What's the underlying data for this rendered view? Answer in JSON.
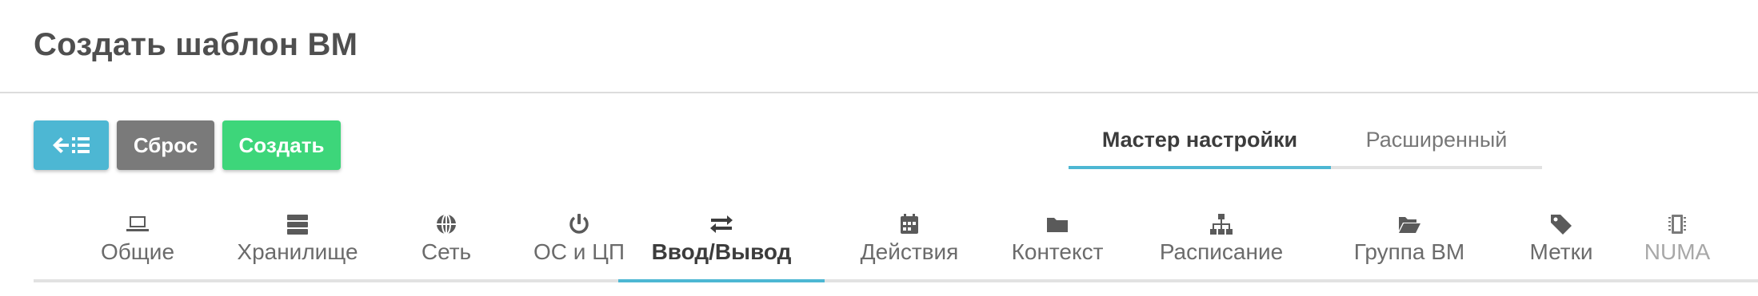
{
  "page": {
    "title": "Создать шаблон ВМ"
  },
  "toolbar": {
    "back_icon": "arrow-left-list-icon",
    "reset_label": "Сброс",
    "create_label": "Создать"
  },
  "mode_tabs": {
    "wizard": "Мастер настройки",
    "advanced": "Расширенный",
    "active": "wizard"
  },
  "section_tabs": {
    "active": "Ввод/Вывод",
    "items": [
      {
        "label": "Общие",
        "icon": "laptop-icon"
      },
      {
        "label": "Хранилище",
        "icon": "server-icon"
      },
      {
        "label": "Сеть",
        "icon": "globe-icon"
      },
      {
        "label": "ОС и ЦП",
        "icon": "power-icon"
      },
      {
        "label": "Ввод/Вывод",
        "icon": "exchange-arrows-icon"
      },
      {
        "label": "Действия",
        "icon": "calendar-icon"
      },
      {
        "label": "Контекст",
        "icon": "folder-icon"
      },
      {
        "label": "Расписание",
        "icon": "sitemap-icon"
      },
      {
        "label": "Группа ВМ",
        "icon": "folder-open-icon"
      },
      {
        "label": "Метки",
        "icon": "tag-icon"
      },
      {
        "label": "NUMA",
        "icon": "microchip-icon"
      }
    ]
  },
  "colors": {
    "accent": "#4db7d3",
    "reset": "#7a7a7a",
    "create": "#3dd67a"
  }
}
